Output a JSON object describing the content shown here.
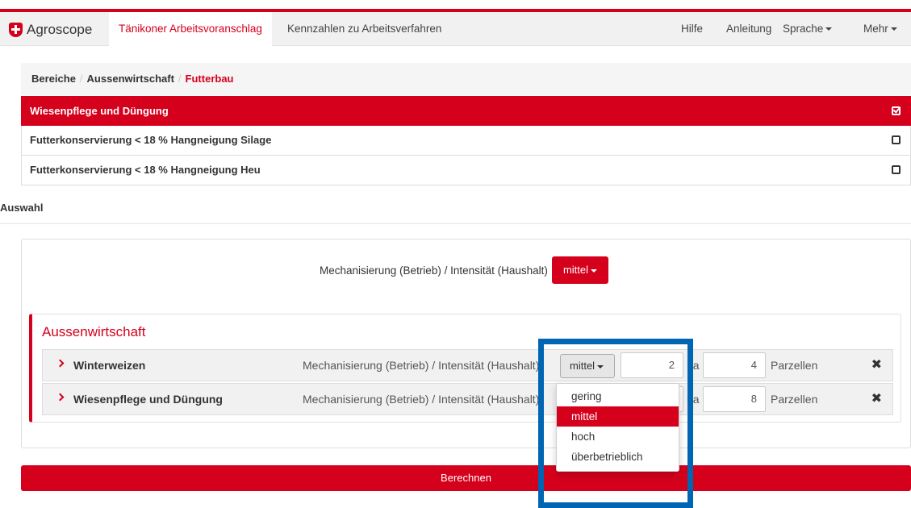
{
  "app": {
    "brand": "Agroscope"
  },
  "nav": {
    "tabs": [
      {
        "label": "Tänikoner Arbeitsvoranschlag",
        "active": true
      },
      {
        "label": "Kennzahlen zu Arbeitsverfahren",
        "active": false
      }
    ],
    "right_items": [
      {
        "label": "Hilfe"
      },
      {
        "label": "Anleitung"
      },
      {
        "label": "Sprache"
      },
      {
        "label": "Mehr"
      }
    ]
  },
  "breadcrumb": {
    "items": [
      "Bereiche",
      "Aussenwirtschaft"
    ],
    "active": "Futterbau"
  },
  "list": {
    "items": [
      {
        "label": "Wiesenpflege und Düngung",
        "checked": true
      },
      {
        "label": "Futterkonservierung < 18 % Hangneigung Silage",
        "checked": false
      },
      {
        "label": "Futterkonservierung < 18 % Hangneigung Heu",
        "checked": false
      }
    ]
  },
  "auswahl": {
    "heading": "Auswahl"
  },
  "global_mech": {
    "label": "Mechanisierung (Betrieb) / Intensität (Haushalt)",
    "value": "mittel"
  },
  "section": {
    "title": "Aussenwirtschaft",
    "rows": [
      {
        "name": "Winterweizen",
        "mech_label": "Mechanisierung (Betrieb) / Intensität (Haushalt)",
        "select": "mittel",
        "ha": "2",
        "ha_unit": "ha",
        "parzellen": "4",
        "parzellen_unit": "Parzellen"
      },
      {
        "name": "Wiesenpflege und Düngung",
        "mech_label": "Mechanisierung (Betrieb) / Intensität (Haushalt)",
        "select": "mittel",
        "ha": "",
        "ha_unit": "ha",
        "parzellen": "8",
        "parzellen_unit": "Parzellen"
      }
    ]
  },
  "dropdown": {
    "options": [
      "gering",
      "mittel",
      "hoch",
      "überbetrieblich"
    ],
    "selected": "mittel"
  },
  "calc_button": {
    "label": "Berechnen"
  },
  "colors": {
    "brand_red": "#d5001c",
    "highlight_blue": "#0066b3"
  }
}
